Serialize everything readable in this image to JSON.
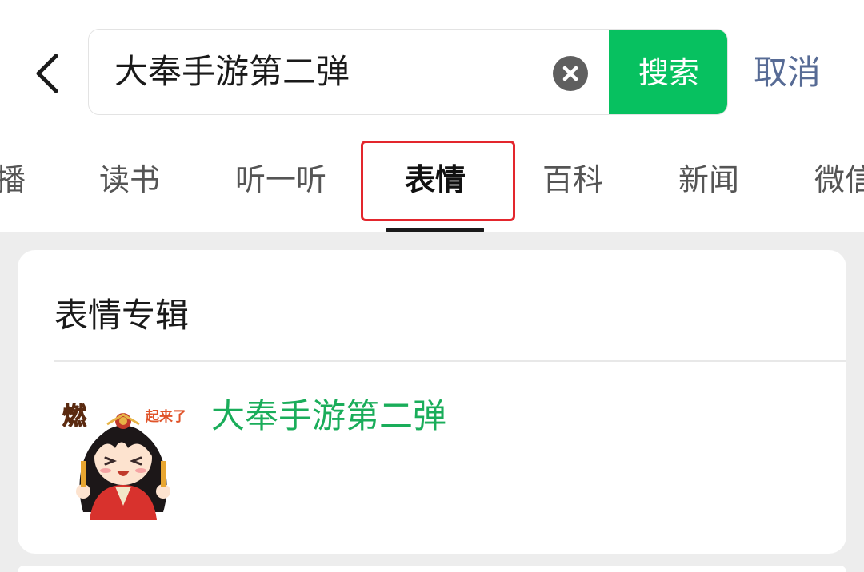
{
  "search": {
    "query": "大奉手游第二弹",
    "button_label": "搜索",
    "cancel_label": "取消"
  },
  "tabs": [
    {
      "label": "播"
    },
    {
      "label": "读书"
    },
    {
      "label": "听一听"
    },
    {
      "label": "表情"
    },
    {
      "label": "百科"
    },
    {
      "label": "新闻"
    },
    {
      "label": "微信"
    }
  ],
  "active_tab": "表情",
  "section": {
    "title": "表情专辑",
    "results": [
      {
        "title": "大奉手游第二弹",
        "thumbnail_text": {
          "big": "燃",
          "small": "起来了"
        }
      }
    ]
  },
  "colors": {
    "accent_green": "#07c160",
    "link_blue": "#576b95",
    "result_green": "#1aad5a",
    "highlight_red": "#e3262d"
  },
  "icons": {
    "back": "chevron-left-icon",
    "clear": "clear-circle-x-icon"
  }
}
